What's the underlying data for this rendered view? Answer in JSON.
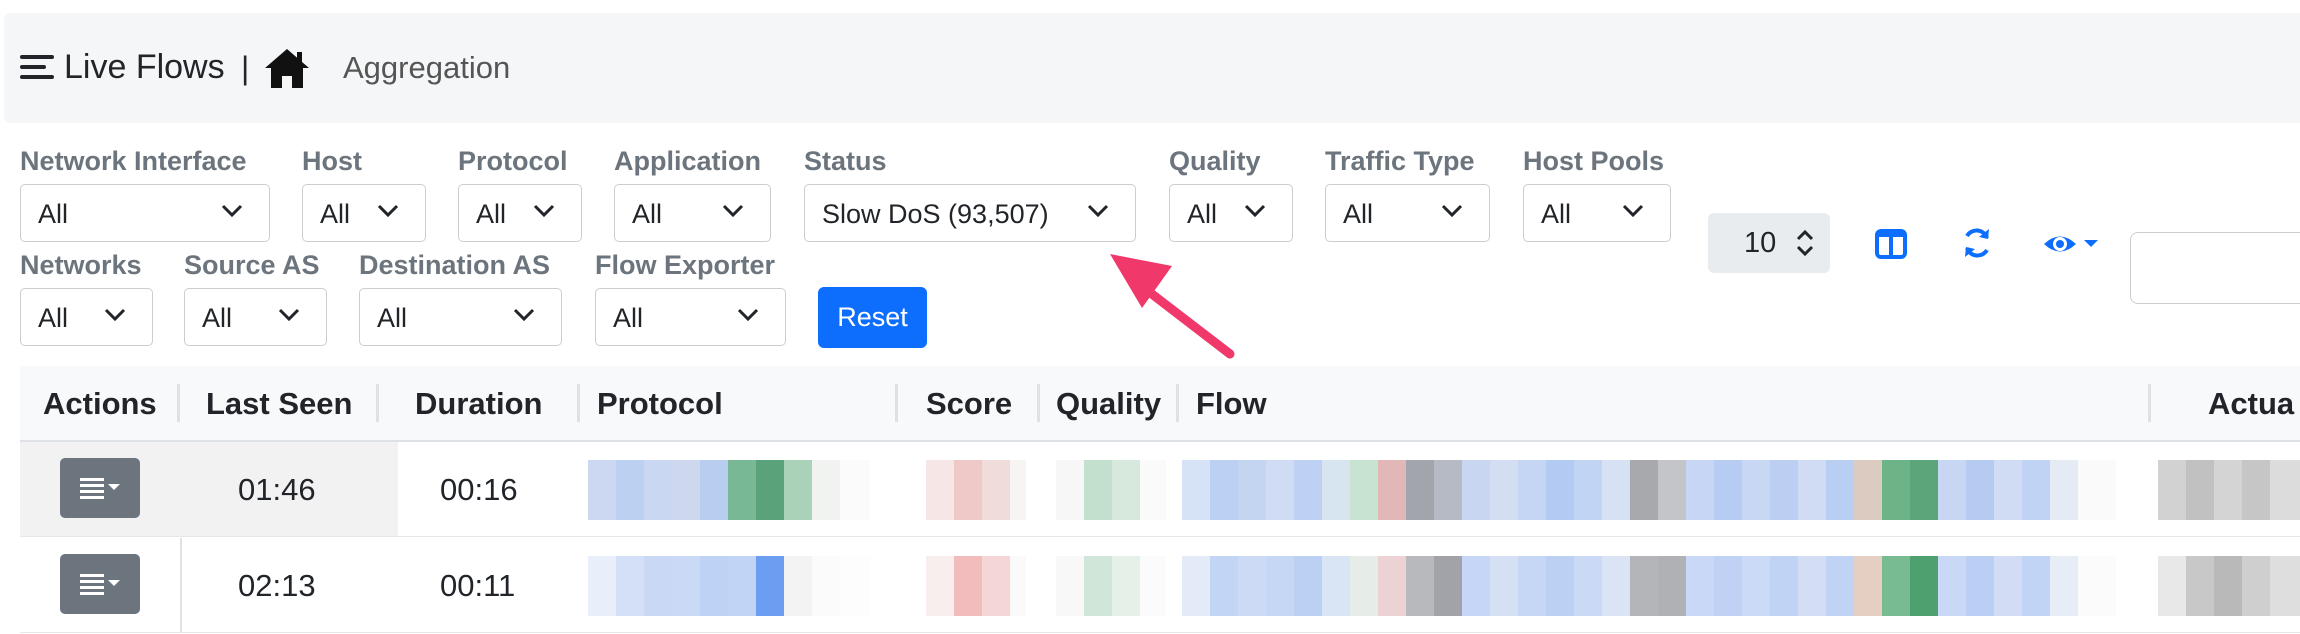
{
  "header": {
    "title": "Live Flows",
    "separator": "|",
    "breadcrumb": "Aggregation"
  },
  "filters": [
    {
      "label": "Network Interface",
      "value": "All"
    },
    {
      "label": "Host",
      "value": "All"
    },
    {
      "label": "Protocol",
      "value": "All"
    },
    {
      "label": "Application",
      "value": "All"
    },
    {
      "label": "Status",
      "value": "Slow DoS (93,507)"
    },
    {
      "label": "Quality",
      "value": "All"
    },
    {
      "label": "Traffic Type",
      "value": "All"
    },
    {
      "label": "Host Pools",
      "value": "All"
    },
    {
      "label": "Networks",
      "value": "All"
    },
    {
      "label": "Source AS",
      "value": "All"
    },
    {
      "label": "Destination AS",
      "value": "All"
    },
    {
      "label": "Flow Exporter",
      "value": "All"
    }
  ],
  "reset_label": "Reset",
  "page_size": "10",
  "icons": [
    "menu-icon",
    "home-icon",
    "columns-icon",
    "refresh-icon",
    "eye-icon",
    "chevron-down-icon",
    "stepper-icon"
  ],
  "colors": {
    "primary": "#0d6efd",
    "arrow": "#f0386b",
    "action_button": "#6c757d",
    "muted_label": "#6c757d"
  },
  "table": {
    "columns": [
      "Actions",
      "Last Seen",
      "Duration",
      "Protocol",
      "Score",
      "Quality",
      "Flow",
      "Actua"
    ],
    "rows": [
      {
        "last_seen": "01:46",
        "duration": "00:16"
      },
      {
        "last_seen": "02:13",
        "duration": "00:11"
      }
    ]
  }
}
